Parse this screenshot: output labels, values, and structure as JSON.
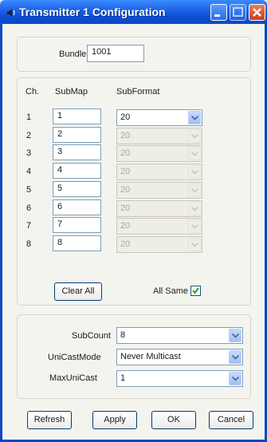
{
  "window": {
    "title": "Transmitter 1 Configuration",
    "icon": "speaker-icon",
    "controls": [
      "minimize-icon",
      "maximize-icon",
      "close-icon"
    ]
  },
  "bundle": {
    "label": "Bundle",
    "value": "1001"
  },
  "table": {
    "headers": {
      "ch": "Ch.",
      "submap": "SubMap",
      "subformat": "SubFormat"
    },
    "rows": [
      {
        "ch": "1",
        "submap": "1",
        "subformat": "20",
        "enabled": true
      },
      {
        "ch": "2",
        "submap": "2",
        "subformat": "20",
        "enabled": false
      },
      {
        "ch": "3",
        "submap": "3",
        "subformat": "20",
        "enabled": false
      },
      {
        "ch": "4",
        "submap": "4",
        "subformat": "20",
        "enabled": false
      },
      {
        "ch": "5",
        "submap": "5",
        "subformat": "20",
        "enabled": false
      },
      {
        "ch": "6",
        "submap": "6",
        "subformat": "20",
        "enabled": false
      },
      {
        "ch": "7",
        "submap": "7",
        "subformat": "20",
        "enabled": false
      },
      {
        "ch": "8",
        "submap": "8",
        "subformat": "20",
        "enabled": false
      }
    ],
    "clear_all_label": "Clear All",
    "all_same_label": "All Same",
    "all_same_checked": true
  },
  "settings": {
    "subcount": {
      "label": "SubCount",
      "value": "8"
    },
    "unicastmode": {
      "label": "UniCastMode",
      "value": "Never Multicast"
    },
    "maxunicast": {
      "label": "MaxUniCast",
      "value": "1"
    }
  },
  "buttons": {
    "refresh": "Refresh",
    "apply": "Apply",
    "ok": "OK",
    "cancel": "Cancel"
  },
  "colors": {
    "titlebar": "#0b48c4",
    "close": "#c9401e",
    "checkmark": "#21a121"
  }
}
